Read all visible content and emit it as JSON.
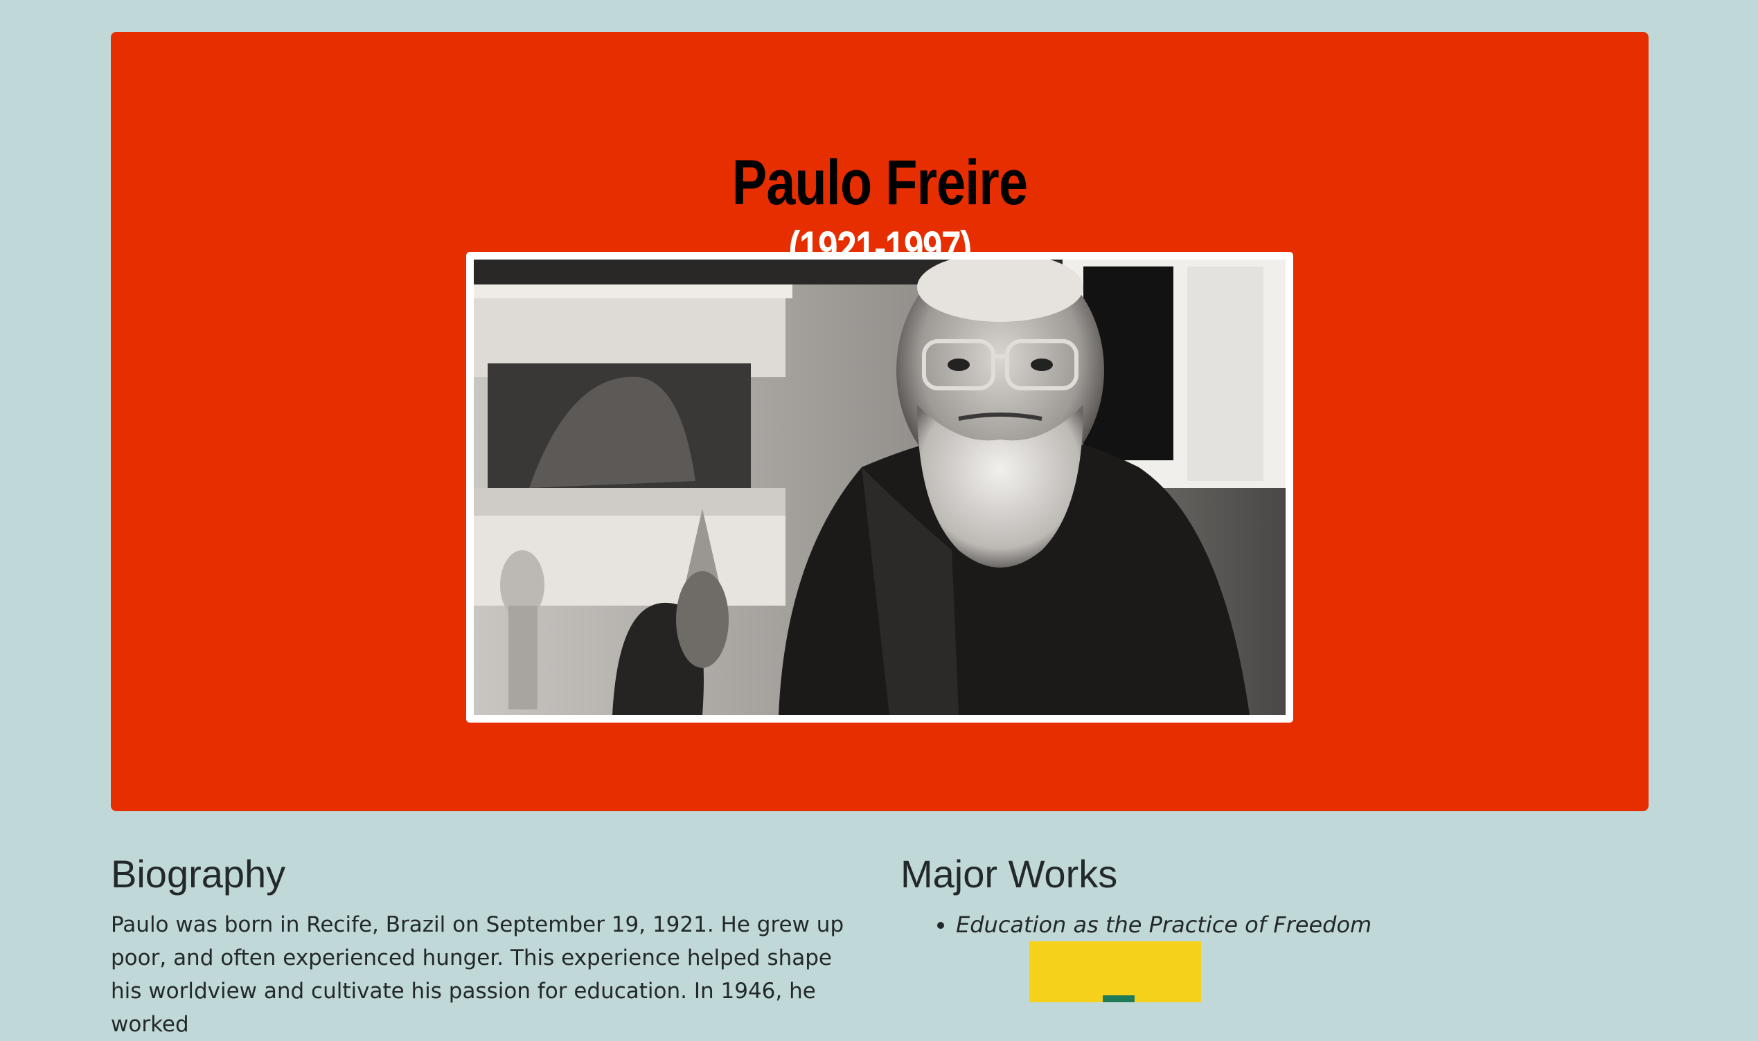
{
  "hero": {
    "name": "Paulo Freire",
    "dates": "(1921-1997)",
    "background_color": "#e62e00"
  },
  "biography": {
    "heading": "Biography",
    "text": "Paulo was born in Recife, Brazil on September 19, 1921. He grew up poor, and often experienced hunger. This experience helped shape his worldview and cultivate his passion for education. In 1946, he worked"
  },
  "major_works": {
    "heading": "Major Works",
    "items": [
      "Education as the Practice of Freedom"
    ]
  },
  "colors": {
    "page_background": "#c1d8d8",
    "text": "#22282b",
    "book_cover": "#f6d11c"
  }
}
